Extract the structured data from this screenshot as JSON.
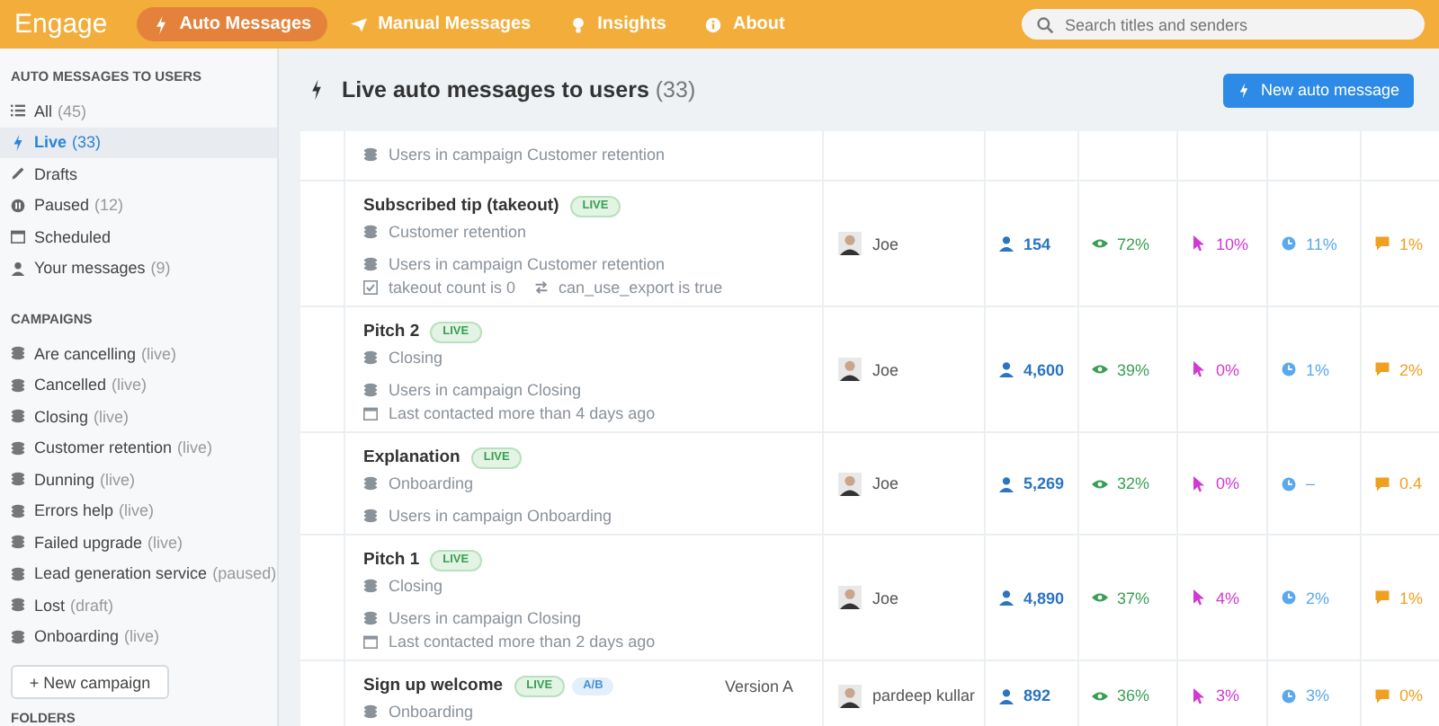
{
  "topbar": {
    "logo": "Engage",
    "tabs": [
      {
        "label": "Auto Messages",
        "selected": true,
        "kind": "bolt"
      },
      {
        "label": "Manual Messages",
        "selected": false,
        "kind": "plane"
      },
      {
        "label": "Insights",
        "selected": false,
        "kind": "bulb"
      },
      {
        "label": "About",
        "selected": false,
        "kind": "info"
      }
    ],
    "search": {
      "placeholder": "Search titles and senders"
    }
  },
  "sidebar": {
    "heading": "AUTO MESSAGES TO USERS",
    "items": [
      {
        "label": "All",
        "count": "(45)",
        "selected": false,
        "kind": "list"
      },
      {
        "label": "Live",
        "count": "(33)",
        "selected": true,
        "kind": "bolt"
      },
      {
        "label": "Drafts",
        "selected": false,
        "kind": "pencil"
      },
      {
        "label": "Paused",
        "count": "(12)",
        "selected": false,
        "kind": "pause"
      },
      {
        "label": "Scheduled",
        "selected": false,
        "kind": "calendar"
      },
      {
        "label": "Your messages",
        "count": "(9)",
        "selected": false,
        "kind": "person"
      }
    ],
    "campaigns_heading": "CAMPAIGNS",
    "campaigns": [
      {
        "label": "Are cancelling",
        "status": "(live)"
      },
      {
        "label": "Cancelled",
        "status": "(live)"
      },
      {
        "label": "Closing",
        "status": "(live)"
      },
      {
        "label": "Customer retention",
        "status": "(live)"
      },
      {
        "label": "Dunning",
        "status": "(live)"
      },
      {
        "label": "Errors help",
        "status": "(live)"
      },
      {
        "label": "Failed upgrade",
        "status": "(live)"
      },
      {
        "label": "Lead generation service",
        "status": "(paused)"
      },
      {
        "label": "Lost",
        "status": "(draft)"
      },
      {
        "label": "Onboarding",
        "status": "(live)"
      }
    ],
    "new_campaign": "+ New campaign",
    "folders_heading": "FOLDERS"
  },
  "main": {
    "title": "Live auto messages to users",
    "count": "(33)",
    "new_button": "New auto message",
    "rows": [
      {
        "conditions": [
          [
            {
              "kind": "stack",
              "text": "Users in campaign Customer retention"
            }
          ]
        ]
      },
      {
        "title": "Subscribed tip (takeout)",
        "badges": [
          {
            "label": "LIVE",
            "kind": "live"
          }
        ],
        "campaign": "Customer retention",
        "conditions": [
          [
            {
              "kind": "stack",
              "text": "Users in campaign Customer retention"
            }
          ],
          [
            {
              "kind": "check",
              "text": "takeout count is 0"
            },
            {
              "kind": "swap",
              "text": "can_use_export is true"
            }
          ]
        ],
        "author": "Joe",
        "stats": [
          {
            "kind": "users",
            "value": "154"
          },
          {
            "kind": "eye",
            "value": "72%"
          },
          {
            "kind": "pointer",
            "value": "10%"
          },
          {
            "kind": "bubble",
            "value": "11%"
          },
          {
            "kind": "speech",
            "value": "1%"
          }
        ]
      },
      {
        "title": "Pitch 2",
        "badges": [
          {
            "label": "LIVE",
            "kind": "live"
          }
        ],
        "campaign": "Closing",
        "conditions": [
          [
            {
              "kind": "stack",
              "text": "Users in campaign Closing"
            }
          ],
          [
            {
              "kind": "calendar",
              "text": "Last contacted more than 4 days ago"
            }
          ]
        ],
        "author": "Joe",
        "stats": [
          {
            "kind": "users",
            "value": "4,600"
          },
          {
            "kind": "eye",
            "value": "39%"
          },
          {
            "kind": "pointer",
            "value": "0%"
          },
          {
            "kind": "bubble",
            "value": "1%"
          },
          {
            "kind": "speech",
            "value": "2%"
          }
        ]
      },
      {
        "title": "Explanation",
        "badges": [
          {
            "label": "LIVE",
            "kind": "live"
          }
        ],
        "campaign": "Onboarding",
        "conditions": [
          [
            {
              "kind": "stack",
              "text": "Users in campaign Onboarding"
            }
          ]
        ],
        "author": "Joe",
        "stats": [
          {
            "kind": "users",
            "value": "5,269"
          },
          {
            "kind": "eye",
            "value": "32%"
          },
          {
            "kind": "pointer",
            "value": "0%"
          },
          {
            "kind": "bubble",
            "value": "–"
          },
          {
            "kind": "speech",
            "value": "0.4"
          }
        ]
      },
      {
        "title": "Pitch 1",
        "badges": [
          {
            "label": "LIVE",
            "kind": "live"
          }
        ],
        "campaign": "Closing",
        "conditions": [
          [
            {
              "kind": "stack",
              "text": "Users in campaign Closing"
            }
          ],
          [
            {
              "kind": "calendar",
              "text": "Last contacted more than 2 days ago"
            }
          ]
        ],
        "author": "Joe",
        "stats": [
          {
            "kind": "users",
            "value": "4,890"
          },
          {
            "kind": "eye",
            "value": "37%"
          },
          {
            "kind": "pointer",
            "value": "4%"
          },
          {
            "kind": "bubble",
            "value": "2%"
          },
          {
            "kind": "speech",
            "value": "1%"
          }
        ]
      },
      {
        "title": "Sign up welcome",
        "badges": [
          {
            "label": "LIVE",
            "kind": "live"
          },
          {
            "label": "A/B",
            "kind": "ab"
          }
        ],
        "version": "Version A",
        "campaign": "Onboarding",
        "author": "pardeep kullar",
        "stats": [
          {
            "kind": "users",
            "value": "892"
          },
          {
            "kind": "eye",
            "value": "36%"
          },
          {
            "kind": "pointer",
            "value": "3%"
          },
          {
            "kind": "bubble",
            "value": "3%"
          },
          {
            "kind": "speech",
            "value": "0%"
          }
        ]
      }
    ]
  }
}
